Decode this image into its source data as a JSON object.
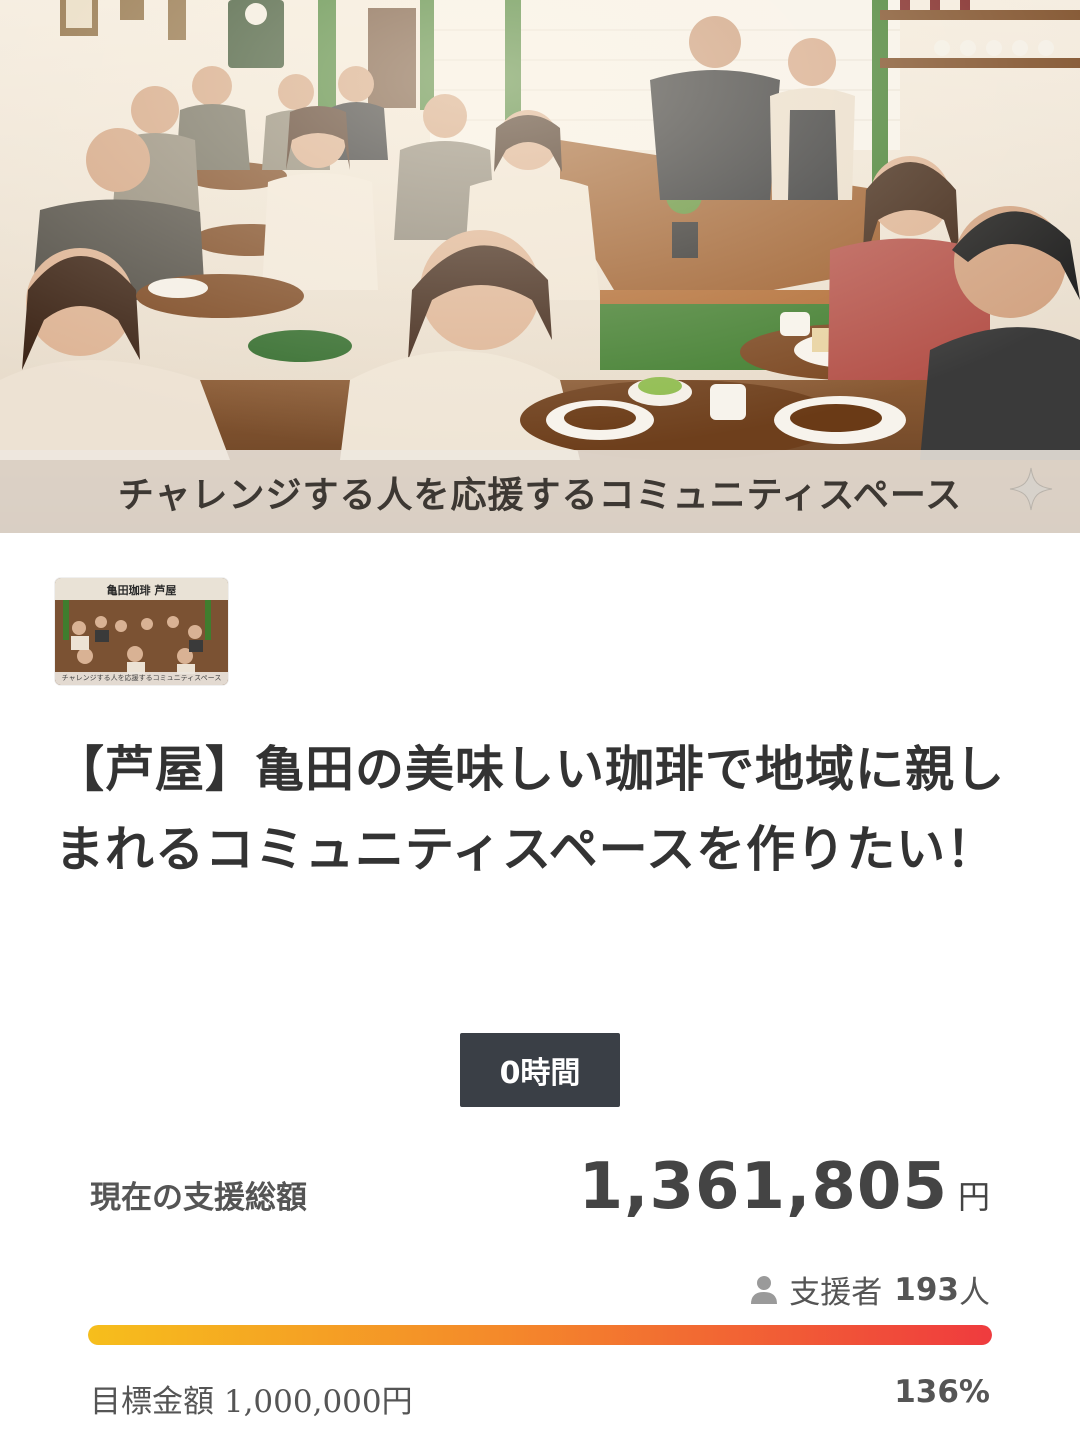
{
  "hero": {
    "caption": "チャレンジする人を応援するコミュニティスペース",
    "sparkle_icon": "sparkle-icon"
  },
  "thumbnail": {
    "title": "亀田珈琲 芦屋",
    "caption": "チャレンジする人を応援するコミュニティスペース"
  },
  "project": {
    "title": "【芦屋】亀田の美味しい珈琲で地域に親しまれるコミュニティスペースを作りたい！"
  },
  "time_badge": "0時間",
  "funding": {
    "label": "現在の支援総額",
    "amount": "1,361,805",
    "unit": "円",
    "supporters_label": "支援者",
    "supporters_count": "193",
    "supporters_unit": "人",
    "goal_label": "目標金額",
    "goal_amount": "1,000,000円",
    "percent": "136%",
    "progress": 1.0
  },
  "colors": {
    "progress_start": "#f6be1c",
    "progress_end": "#ef3b3e",
    "badge_bg": "#3a3f46"
  }
}
